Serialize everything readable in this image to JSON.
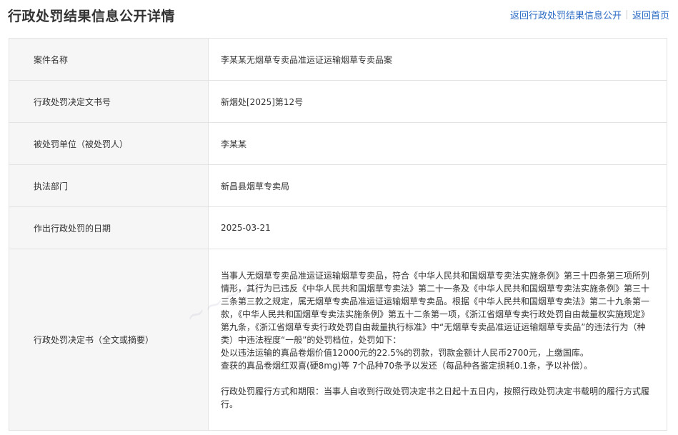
{
  "header": {
    "title": "行政处罚结果信息公开详情",
    "link_back_list": "返回行政处罚结果信息公开",
    "link_home": "返回首页"
  },
  "rows": [
    {
      "label": "案件名称",
      "value": "李某某无烟草专卖品准运证运输烟草专卖品案"
    },
    {
      "label": "行政处罚决定文书号",
      "value": "新烟处[2025]第12号"
    },
    {
      "label": "被处罚单位（被处罚人）",
      "value": "李某某"
    },
    {
      "label": "执法部门",
      "value": "新昌县烟草专卖局"
    },
    {
      "label": "作出行政处罚的日期",
      "value": "2025-03-21"
    }
  ],
  "decision": {
    "label": "行政处罚决定书（全文或摘要）",
    "para1": "当事人无烟草专卖品准运证运输烟草专卖品，符合《中华人民共和国烟草专卖法实施条例》第三十四条第三项所列情形，其行为已违反《中华人民共和国烟草专卖法》第二十一条及《中华人民共和国烟草专卖法实施条例》第三十三条第三款之规定，属无烟草专卖品准运证运输烟草专卖品。根据《中华人民共和国烟草专卖法》第二十九条第一款，《中华人民共和国烟草专卖法实施条例》第五十二条第一项，《浙江省烟草专卖行政处罚自由裁量权实施规定》第九条，《浙江省烟草专卖行政处罚自由裁量执行标准》中“无烟草专卖品准运证运输烟草专卖品”的违法行为（种类）中违法程度“一般”的处罚档位，处罚如下：",
    "para2": "处以违法运输的真品卷烟价值12000元的22.5%的罚款，罚款金额计人民币2700元，上缴国库。",
    "para3": "查获的真品卷烟红双喜(硬8mg)等 7个品种70条予以发还（每品种各鉴定损耗0.1条，予以补偿）。",
    "para4": "行政处罚履行方式和期限：当事人自收到行政处罚决定书之日起十五日内，按照行政处罚决定书载明的履行方式履行。"
  }
}
